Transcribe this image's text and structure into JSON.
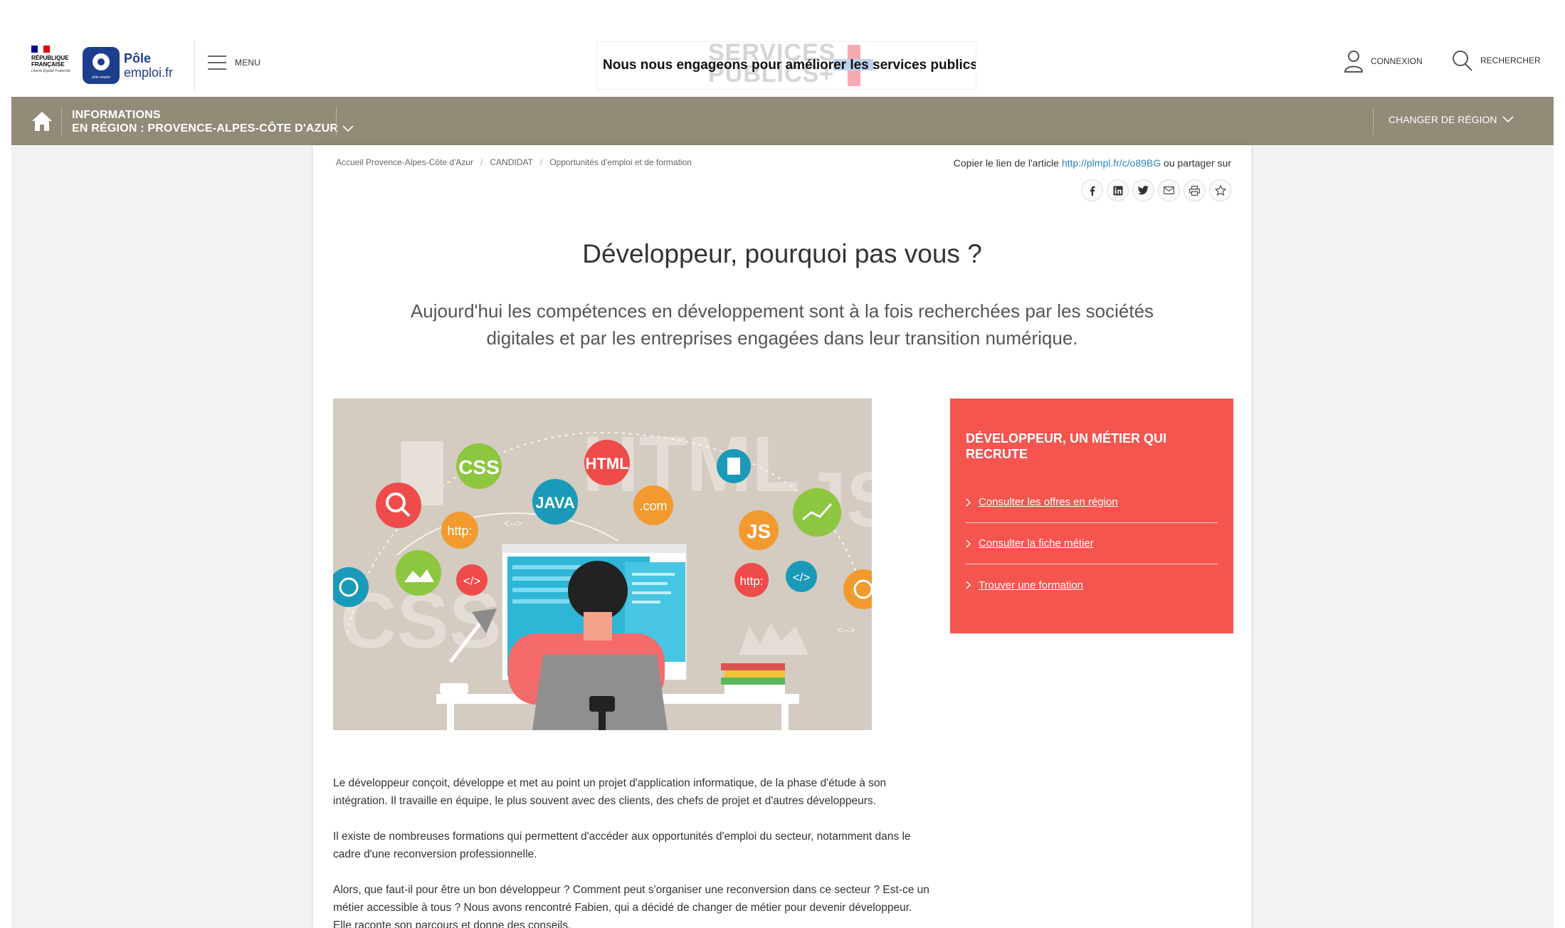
{
  "header": {
    "rf_text": "RÉPUBLIQUE\nFRANÇAISE",
    "rf_motto": "Liberté Égalité Fraternité",
    "pe_name_line1": "Pôle",
    "pe_name_line2": "emploi.fr",
    "pe_badge_sub": "pôle emploi",
    "menu_label": "MENU",
    "services_bg_line1": "SERVICES",
    "services_bg_line2": "PUBLICS+",
    "services_text": "Nous nous engageons pour améliorer les services publics",
    "connexion_label": "CONNEXION",
    "rechercher_label": "RECHERCHER"
  },
  "regionbar": {
    "info_line1": "INFORMATIONS",
    "info_line2": "EN RÉGION : PROVENCE-ALPES-CÔTE D'AZUR",
    "change_region": "CHANGER DE RÉGION",
    "bg_color": "#918b77"
  },
  "breadcrumb": {
    "items": [
      "Accueil Provence-Alpes-Côte d'Azur",
      "CANDIDAT",
      "Opportunités d'emploi et de formation"
    ]
  },
  "share": {
    "prefix": "Copier le lien de l'article",
    "link": "http://plmpl.fr/c/o89BG",
    "suffix": "ou partager sur",
    "icons": [
      "facebook-icon",
      "linkedin-icon",
      "twitter-icon",
      "email-icon",
      "print-icon",
      "favorite-icon"
    ]
  },
  "article": {
    "title": "Développeur, pourquoi pas vous ?",
    "lead": "Aujourd'hui les compétences en développement sont à la fois recherchées par les sociétés digitales et par les entreprises engagées dans leur transition numérique.",
    "illustration_labels": {
      "css": "CSS",
      "html": "HTML",
      "java": "JAVA",
      "com": ".com",
      "http": "http:",
      "js": "JS",
      "code": "</>",
      "arrows": "<-->"
    },
    "paragraphs": [
      "Le développeur conçoit, développe et met au point un projet d'application informatique, de la phase d'étude à son intégration. Il travaille en équipe, le plus souvent avec des clients, des chefs de projet et d'autres développeurs.",
      "Il existe de nombreuses formations qui permettent d'accéder aux opportunités d'emploi du secteur, notamment dans le cadre d'une reconversion professionnelle.",
      "Alors, que faut-il pour être un bon développeur ? Comment peut s'organiser une reconversion dans ce secteur ? Est-ce un métier accessible à tous ? Nous avons rencontré Fabien, qui a décidé de changer de métier pour devenir développeur. Elle raconte son parcours et donne des conseils."
    ]
  },
  "cta": {
    "title": "DÉVELOPPEUR, UN MÉTIER QUI RECRUTE",
    "links": [
      "Consulter les offres en région",
      "Consulter la fiche métier",
      "Trouver une formation"
    ],
    "bg_color": "#f4554e"
  }
}
